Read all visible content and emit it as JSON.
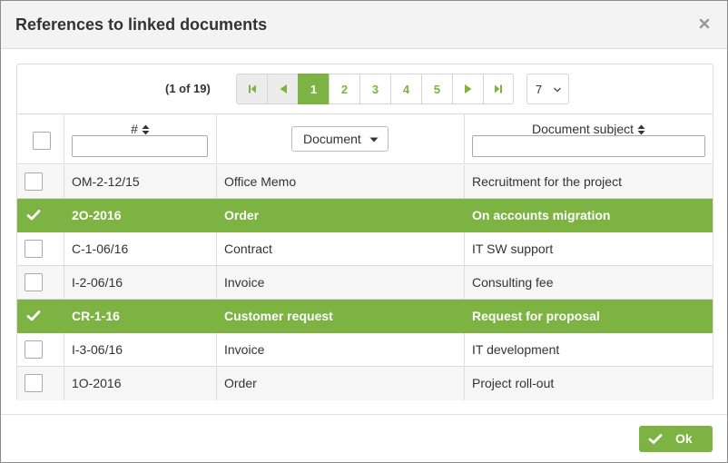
{
  "dialog": {
    "title": "References to linked documents",
    "close_icon": "close-icon"
  },
  "pager": {
    "info": "(1 of 19)",
    "pages": [
      "1",
      "2",
      "3",
      "4",
      "5"
    ],
    "current_page": "1",
    "rows_per_page": "7",
    "icons": [
      "first-page-icon",
      "prev-page-icon",
      "next-page-icon",
      "last-page-icon"
    ]
  },
  "table": {
    "headers": {
      "number": "#",
      "document": "Document",
      "subject": "Document subject"
    },
    "filters": {
      "number": "",
      "subject": ""
    },
    "rows": [
      {
        "number": "OM-2-12/15",
        "document": "Office Memo",
        "subject": "Recruitment for the project",
        "checked": false
      },
      {
        "number": "2O-2016",
        "document": "Order",
        "subject": "On accounts migration",
        "checked": true
      },
      {
        "number": "C-1-06/16",
        "document": "Contract",
        "subject": "IT SW support",
        "checked": false
      },
      {
        "number": "I-2-06/16",
        "document": "Invoice",
        "subject": "Consulting fee",
        "checked": false
      },
      {
        "number": "CR-1-16",
        "document": "Customer request",
        "subject": "Request for proposal",
        "checked": true
      },
      {
        "number": "I-3-06/16",
        "document": "Invoice",
        "subject": "IT development",
        "checked": false
      },
      {
        "number": "1O-2016",
        "document": "Order",
        "subject": "Project roll-out",
        "checked": false
      }
    ]
  },
  "footer": {
    "ok_label": "Ok"
  },
  "colors": {
    "accent": "#7cb342",
    "border": "#dcdcdc",
    "stripe": "#f6f6f6"
  }
}
